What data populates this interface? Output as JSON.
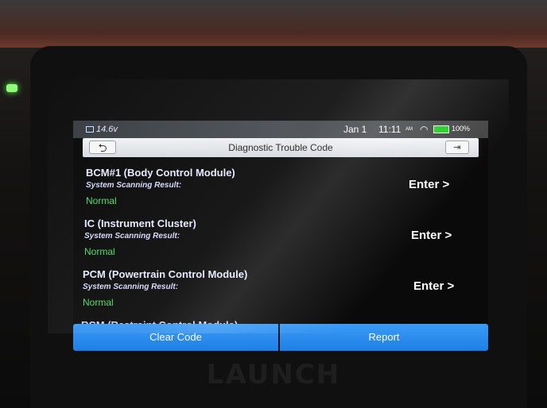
{
  "status_bar": {
    "voltage": "14.6v",
    "date": "Jan 1",
    "time": "11:11",
    "ampm": "AM",
    "battery": "100%",
    "icons": [
      "car-battery-icon",
      "wifi-icon",
      "battery-icon"
    ]
  },
  "title_bar": {
    "title": "Diagnostic Trouble Code",
    "back_symbol": "⮌",
    "exit_symbol": "⇥"
  },
  "modules": [
    {
      "name": "BCM#1 (Body Control Module)",
      "label": "System Scanning Result:",
      "result": "Normal",
      "action": "Enter >"
    },
    {
      "name": "IC (Instrument Cluster)",
      "label": "System Scanning Result:",
      "result": "Normal",
      "action": "Enter >"
    },
    {
      "name": "PCM (Powertrain Control Module)",
      "label": "System Scanning Result:",
      "result": "Normal",
      "action": "Enter >"
    }
  ],
  "partial_module": "RCM (Restraint Control Module)",
  "buttons": {
    "clear_code": "Clear Code",
    "report": "Report"
  },
  "device": {
    "brand": "LAUNCH"
  },
  "colors": {
    "accent": "#2a8cf0",
    "status_ok": "#48e060",
    "battery": "#1fd11f"
  }
}
